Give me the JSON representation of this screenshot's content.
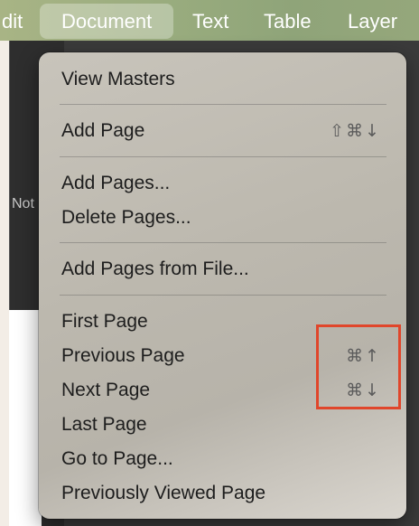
{
  "menubar": {
    "items": [
      {
        "label": "dit"
      },
      {
        "label": "Document",
        "active": true
      },
      {
        "label": "Text"
      },
      {
        "label": "Table"
      },
      {
        "label": "Layer"
      }
    ]
  },
  "background": {
    "fragment_not": "Not"
  },
  "menu": {
    "items": [
      {
        "label": "View Masters"
      },
      {
        "label": "Add Page",
        "shortcut": "⇧⌘↓"
      },
      {
        "label": "Add Pages..."
      },
      {
        "label": "Delete Pages..."
      },
      {
        "label": "Add Pages from File..."
      },
      {
        "label": "First Page"
      },
      {
        "label": "Previous Page",
        "shortcut": "⌘↑"
      },
      {
        "label": "Next Page",
        "shortcut": "⌘↓"
      },
      {
        "label": "Last Page"
      },
      {
        "label": "Go to Page..."
      },
      {
        "label": "Previously Viewed Page"
      }
    ]
  },
  "colors": {
    "highlight": "#e0462b",
    "menubar": "#99ac7e"
  }
}
